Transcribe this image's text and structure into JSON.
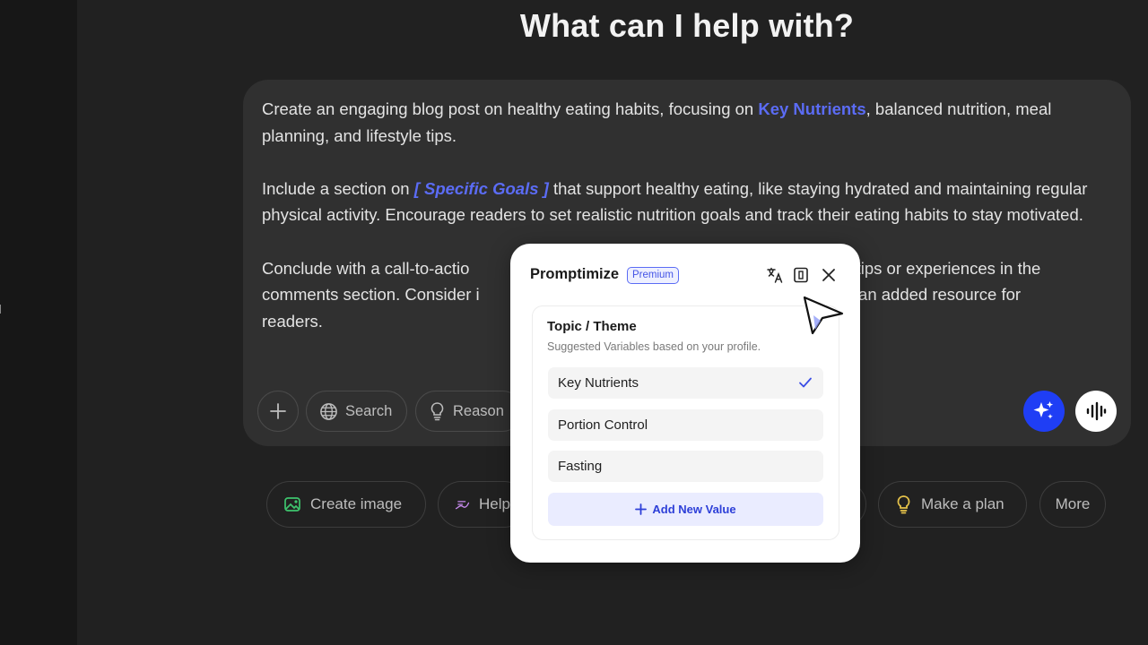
{
  "heading": "What can I help with?",
  "prompt": {
    "p1_pre": "Create an engaging blog post on healthy eating habits, focusing on ",
    "p1_var": "Key Nutrients",
    "p1_post": ", balanced nutrition, meal planning, and lifestyle tips.",
    "p2_pre": "Include a section on ",
    "p2_var": "[ Specific Goals ]",
    "p2_post": " that support healthy eating, like staying hydrated and maintaining regular physical activity. Encourage readers to set realistic nutrition goals and track their eating habits to stay motivated.",
    "p3_a": "Conclude with a call-to-actio",
    "p3_b": "nting tips or experiences in the",
    "p3_c": "comments section. Consider i",
    "p3_d": "s an added resource for",
    "p3_e": "readers."
  },
  "composer_tools": {
    "search_label": "Search",
    "reason_label": "Reason"
  },
  "suggestions": {
    "create_image": "Create image",
    "help": "Help",
    "make_plan": "Make a plan",
    "more": "More"
  },
  "popup": {
    "title": "Promptimize",
    "badge": "Premium",
    "card_title": "Topic / Theme",
    "card_subtitle": "Suggested Variables based on your profile.",
    "options": [
      {
        "label": "Key Nutrients",
        "selected": true
      },
      {
        "label": "Portion Control",
        "selected": false
      },
      {
        "label": "Fasting",
        "selected": false
      }
    ],
    "add_label": "Add New Value"
  },
  "colors": {
    "background": "#212121",
    "composer": "#303030",
    "accent": "#5b6cf5",
    "sparkle_button": "#1f3ef5"
  },
  "icons": [
    "plus-icon",
    "globe-icon",
    "lightbulb-icon",
    "sparkle-icon",
    "voice-waveform-icon",
    "image-icon",
    "pen-icon",
    "translate-icon",
    "panel-icon",
    "close-icon",
    "check-icon",
    "cursor-icon"
  ]
}
